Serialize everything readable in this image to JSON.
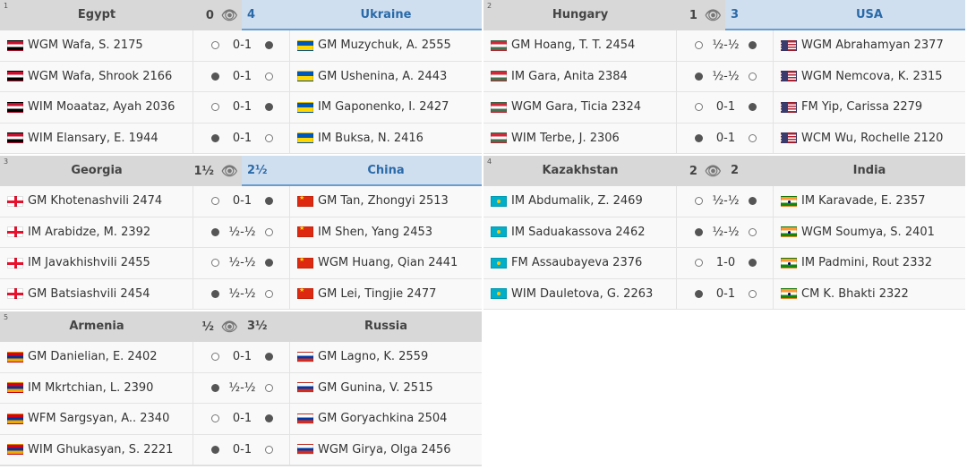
{
  "matches": [
    {
      "num": "1",
      "left_team": "Egypt",
      "left_score": "0",
      "right_score": "4",
      "right_team": "Ukraine",
      "winner": "right",
      "left_flag": "egypt",
      "right_flag": "ukraine",
      "boards": [
        {
          "left": "WGM Wafa, S. 2175",
          "left_color": "white",
          "result": "0-1",
          "right": "GM Muzychuk, A. 2555",
          "right_color": "black"
        },
        {
          "left": "WGM Wafa, Shrook 2166",
          "left_color": "black",
          "result": "0-1",
          "right": "GM Ushenina, A. 2443",
          "right_color": "white"
        },
        {
          "left": "WIM Moaataz, Ayah 2036",
          "left_color": "white",
          "result": "0-1",
          "right": "IM Gaponenko, I. 2427",
          "right_color": "black"
        },
        {
          "left": "WIM Elansary, E. 1944",
          "left_color": "black",
          "result": "0-1",
          "right": "IM Buksa, N. 2416",
          "right_color": "white"
        }
      ]
    },
    {
      "num": "2",
      "left_team": "Hungary",
      "left_score": "1",
      "right_score": "3",
      "right_team": "USA",
      "winner": "right",
      "left_flag": "hungary",
      "right_flag": "usa",
      "boards": [
        {
          "left": "GM Hoang, T. T. 2454",
          "left_color": "white",
          "result": "½-½",
          "right": "WGM Abrahamyan 2377",
          "right_color": "black"
        },
        {
          "left": "IM Gara, Anita 2384",
          "left_color": "black",
          "result": "½-½",
          "right": "WGM Nemcova, K. 2315",
          "right_color": "white"
        },
        {
          "left": "WGM Gara, Ticia 2324",
          "left_color": "white",
          "result": "0-1",
          "right": "FM Yip, Carissa 2279",
          "right_color": "black"
        },
        {
          "left": "WIM Terbe, J. 2306",
          "left_color": "black",
          "result": "0-1",
          "right": "WCM Wu, Rochelle 2120",
          "right_color": "white"
        }
      ]
    },
    {
      "num": "3",
      "left_team": "Georgia",
      "left_score": "1½",
      "right_score": "2½",
      "right_team": "China",
      "winner": "right",
      "left_flag": "georgia",
      "right_flag": "china",
      "boards": [
        {
          "left": "GM Khotenashvili 2474",
          "left_color": "white",
          "result": "0-1",
          "right": "GM Tan, Zhongyi 2513",
          "right_color": "black"
        },
        {
          "left": "IM Arabidze, M. 2392",
          "left_color": "black",
          "result": "½-½",
          "right": "IM Shen, Yang 2453",
          "right_color": "white"
        },
        {
          "left": "IM Javakhishvili 2455",
          "left_color": "white",
          "result": "½-½",
          "right": "WGM Huang, Qian 2441",
          "right_color": "black"
        },
        {
          "left": "GM Batsiashvili 2454",
          "left_color": "black",
          "result": "½-½",
          "right": "GM Lei, Tingjie 2477",
          "right_color": "white"
        }
      ]
    },
    {
      "num": "4",
      "left_team": "Kazakhstan",
      "left_score": "2",
      "right_score": "2",
      "right_team": "India",
      "winner": "none",
      "left_flag": "kazakhstan",
      "right_flag": "india",
      "boards": [
        {
          "left": "IM Abdumalik, Z. 2469",
          "left_color": "white",
          "result": "½-½",
          "right": "IM Karavade, E. 2357",
          "right_color": "black"
        },
        {
          "left": "IM Saduakassova 2462",
          "left_color": "black",
          "result": "½-½",
          "right": "WGM Soumya, S. 2401",
          "right_color": "white"
        },
        {
          "left": "FM Assaubayeva 2376",
          "left_color": "white",
          "result": "1-0",
          "right": "IM Padmini, Rout 2332",
          "right_color": "black"
        },
        {
          "left": "WIM Dauletova, G. 2263",
          "left_color": "black",
          "result": "0-1",
          "right": "CM K. Bhakti 2322",
          "right_color": "white"
        }
      ]
    },
    {
      "num": "5",
      "left_team": "Armenia",
      "left_score": "½",
      "right_score": "3½",
      "right_team": "Russia",
      "winner": "none",
      "left_flag": "armenia",
      "right_flag": "russia",
      "boards": [
        {
          "left": "GM Danielian, E. 2402",
          "left_color": "white",
          "result": "0-1",
          "right": "GM Lagno, K. 2559",
          "right_color": "black"
        },
        {
          "left": "IM Mkrtchian, L. 2390",
          "left_color": "black",
          "result": "½-½",
          "right": "GM Gunina, V. 2515",
          "right_color": "white"
        },
        {
          "left": "WFM Sargsyan, A.. 2340",
          "left_color": "white",
          "result": "0-1",
          "right": "GM Goryachkina 2504",
          "right_color": "black"
        },
        {
          "left": "WIM Ghukasyan, S. 2221",
          "left_color": "black",
          "result": "0-1",
          "right": "WGM Girya, Olga 2456",
          "right_color": "white"
        }
      ]
    }
  ]
}
